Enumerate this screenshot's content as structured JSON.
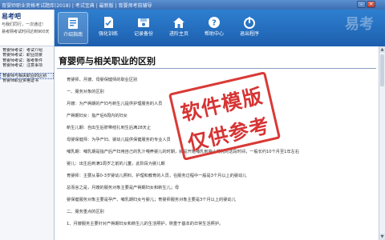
{
  "window": {
    "title": "育婴师职业资格考试题库(2018) | 考试宝典 | 最新版 | 育婴师考前辅导",
    "controls": {
      "minimize": "–",
      "maximize": "□",
      "close": "×"
    }
  },
  "logo": {
    "name": "易考吧",
    "slogan_line1": "与我们同行，一次通过!",
    "slogan_line2": "易考网考试时间达到900天"
  },
  "toolbar": {
    "items": [
      {
        "label": "介绍指南",
        "icon": "guide-icon",
        "active": true
      },
      {
        "label": "强化训练",
        "icon": "training-icon",
        "active": false
      },
      {
        "label": "记录备份",
        "icon": "backup-icon",
        "active": false
      },
      {
        "label": "进阶主页",
        "icon": "home-icon",
        "active": false
      },
      {
        "label": "帮助中心",
        "icon": "help-icon",
        "active": false
      },
      {
        "label": "退出程序",
        "icon": "exit-icon",
        "active": false
      }
    ],
    "brand": "易考"
  },
  "sidebar": {
    "items": [
      "育婴师考试：考试介绍",
      "育婴师考试：职业前景",
      "育婴师考试：报考条件",
      "育婴师考试：注意事项",
      "",
      "育婴师与相关职业的区别",
      "育婴师职业资格证书"
    ],
    "selected_index": 5
  },
  "article": {
    "title": "育婴师与相关职业的区别",
    "lines": [
      "育婴师、月嫂、母婴保健师的职业区别",
      "一、服务对象的区别",
      "月嫂：为产褥期的产妇与新生儿提供护理服务的人员",
      "产褥期妇女：指产后6周内的妇女",
      "新生儿期：自出生后脐带结扎到生后满28天止",
      "母婴保健师：为孕产妇、婴幼儿提供保健服务的专业人员",
      "哺乳期：哺乳期是指产后产妇用自己的乳汁喂养婴儿的时期，就是开始哺乳到停止哺乳的这段时间，一般长约10个月至1年左右",
      "婴儿：出生后到满1周岁之前的儿童，此阶段为婴儿期",
      "育婴师：主要从事0-3岁婴幼儿照料、护理和教育的人员，在服务过程中一般是3个月以上的婴幼儿",
      "总而言之是，月嫂的服务对象主要是产褥期妇女和新生儿；母",
      "婴保健服务对象主要是孕产、哺乳期妇女与婴儿；育婴师服务对象主要是3个月以上的婴幼儿",
      "二、服务重点的区别",
      "1、月嫂服务主要针对产褥期妇女和新生儿的生活照护，侧重于基本的日常生活照护。"
    ]
  },
  "watermark": {
    "line1": "软件模版",
    "line2": "仅供参考"
  },
  "scrollbar": {
    "up": "▲",
    "down": "▼",
    "position": 0.05
  },
  "colors": {
    "titlebar": "#3c6fb2",
    "toolbar": "#1d5fae",
    "stamp": "#d93a36"
  }
}
